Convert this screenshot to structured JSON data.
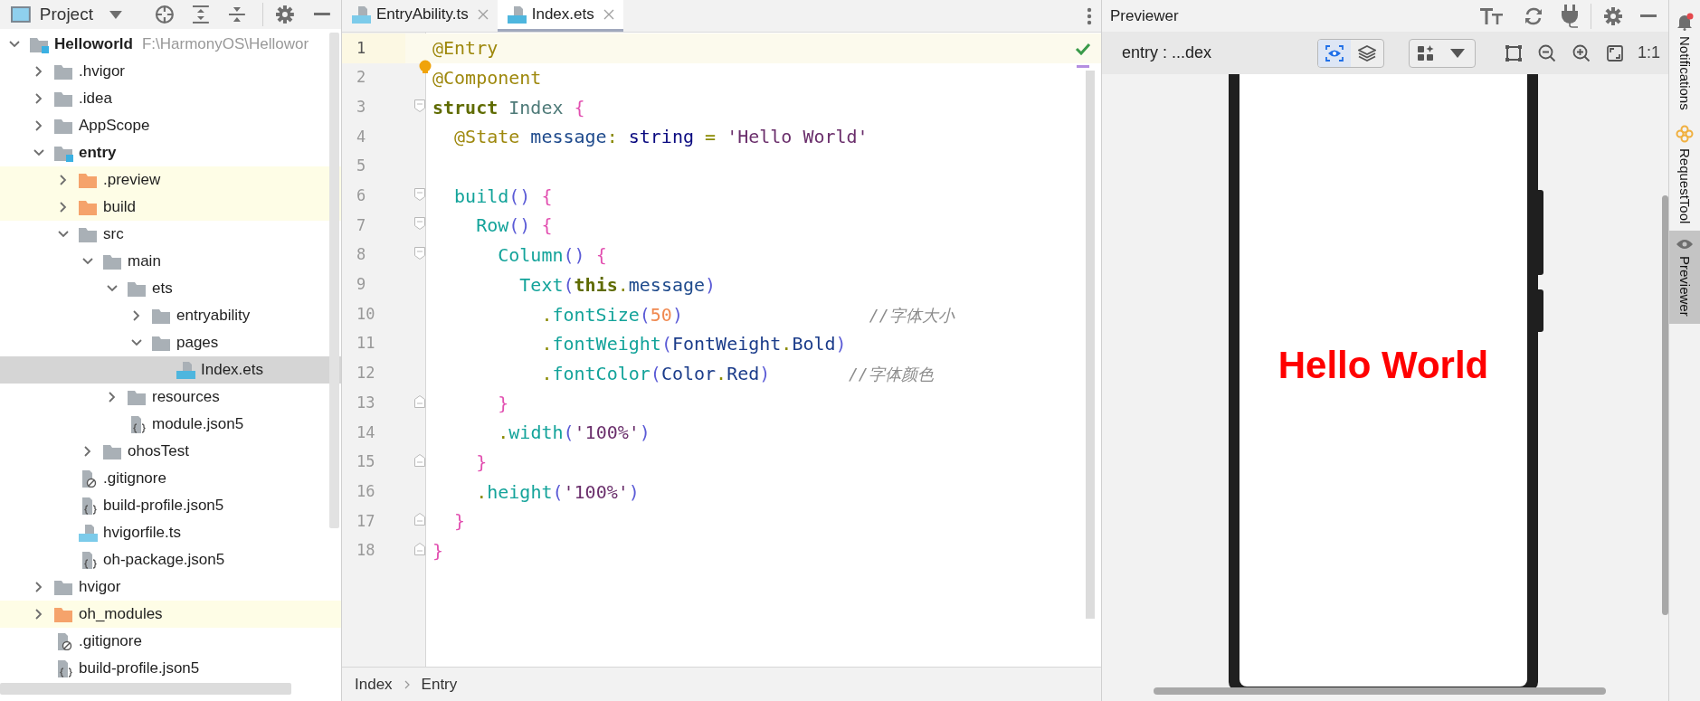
{
  "project_panel": {
    "title": "Project",
    "tree": [
      {
        "label": "Helloworld",
        "kind": "module",
        "hint": "F:\\HarmonyOS\\Hellowor",
        "expanded": true,
        "selected": false,
        "children": [
          {
            "label": ".hvigor",
            "kind": "folder",
            "expanded": false,
            "selected": false
          },
          {
            "label": ".idea",
            "kind": "folder",
            "expanded": false,
            "selected": false
          },
          {
            "label": "AppScope",
            "kind": "folder",
            "expanded": false,
            "selected": false
          },
          {
            "label": "entry",
            "kind": "module",
            "expanded": true,
            "selected": false,
            "children": [
              {
                "label": ".preview",
                "kind": "excluded",
                "expanded": false,
                "selected": false
              },
              {
                "label": "build",
                "kind": "excluded",
                "expanded": false,
                "selected": false
              },
              {
                "label": "src",
                "kind": "folder",
                "expanded": true,
                "selected": false,
                "children": [
                  {
                    "label": "main",
                    "kind": "folder",
                    "expanded": true,
                    "selected": false,
                    "children": [
                      {
                        "label": "ets",
                        "kind": "folder",
                        "expanded": true,
                        "selected": false,
                        "children": [
                          {
                            "label": "entryability",
                            "kind": "folder",
                            "expanded": false,
                            "selected": false
                          },
                          {
                            "label": "pages",
                            "kind": "folder",
                            "expanded": true,
                            "selected": false,
                            "children": [
                              {
                                "label": "Index.ets",
                                "kind": "ets",
                                "selected": true
                              }
                            ]
                          }
                        ]
                      },
                      {
                        "label": "resources",
                        "kind": "folder",
                        "expanded": false,
                        "selected": false
                      },
                      {
                        "label": "module.json5",
                        "kind": "json",
                        "selected": false
                      }
                    ]
                  },
                  {
                    "label": "ohosTest",
                    "kind": "folder",
                    "expanded": false,
                    "selected": false
                  }
                ]
              },
              {
                "label": ".gitignore",
                "kind": "ignore",
                "selected": false
              },
              {
                "label": "build-profile.json5",
                "kind": "json",
                "selected": false
              },
              {
                "label": "hvigorfile.ts",
                "kind": "ts",
                "selected": false
              },
              {
                "label": "oh-package.json5",
                "kind": "json",
                "selected": false
              }
            ]
          },
          {
            "label": "hvigor",
            "kind": "folder",
            "expanded": false,
            "selected": false
          },
          {
            "label": "oh_modules",
            "kind": "excluded",
            "expanded": false,
            "selected": false
          },
          {
            "label": ".gitignore",
            "kind": "ignore",
            "selected": false
          },
          {
            "label": "build-profile.json5",
            "kind": "json",
            "selected": false
          }
        ]
      }
    ]
  },
  "editor": {
    "tabs": [
      {
        "label": "EntryAbility.ts",
        "kind": "ts",
        "selected": false
      },
      {
        "label": "Index.ets",
        "kind": "ets",
        "selected": true
      }
    ],
    "lines": [
      {
        "number": "1",
        "current": true,
        "tokens": [
          {
            "text": "@Entry",
            "kind": "decorator"
          }
        ]
      },
      {
        "number": "2",
        "current": false,
        "tokens": [
          {
            "text": "@Component",
            "kind": "decorator"
          }
        ]
      },
      {
        "number": "3",
        "current": false,
        "kind": "fold-start",
        "tokens": [
          {
            "text": "struct",
            "kind": "keyword"
          },
          {
            "text": " Index",
            "kind": "type-name"
          },
          {
            "text": " {",
            "kind": "brace"
          }
        ]
      },
      {
        "number": "4",
        "current": false,
        "tokens": [
          {
            "text": "  @State",
            "kind": "decorator"
          },
          {
            "text": " message",
            "kind": "field"
          },
          {
            "text": ":",
            "kind": "operator"
          },
          {
            "text": " string",
            "kind": "type"
          },
          {
            "text": " = ",
            "kind": "operator"
          },
          {
            "text": "'Hello World'",
            "kind": "string"
          }
        ]
      },
      {
        "number": "5",
        "current": false
      },
      {
        "number": "6",
        "current": false,
        "kind": "fold-start",
        "tokens": [
          {
            "text": "  build",
            "kind": "call"
          },
          {
            "text": "()",
            "kind": "paren"
          },
          {
            "text": " {",
            "kind": "brace"
          }
        ]
      },
      {
        "number": "7",
        "current": false,
        "kind": "fold-start",
        "tokens": [
          {
            "text": "    Row",
            "kind": "call"
          },
          {
            "text": "()",
            "kind": "paren"
          },
          {
            "text": " {",
            "kind": "brace"
          }
        ]
      },
      {
        "number": "8",
        "current": false,
        "kind": "fold-start",
        "tokens": [
          {
            "text": "      Column",
            "kind": "call"
          },
          {
            "text": "()",
            "kind": "paren"
          },
          {
            "text": " {",
            "kind": "brace"
          }
        ]
      },
      {
        "number": "9",
        "current": false,
        "tokens": [
          {
            "text": "        Text",
            "kind": "call"
          },
          {
            "text": "(",
            "kind": "paren"
          },
          {
            "text": "this",
            "kind": "keyword"
          },
          {
            "text": ".",
            "kind": "operator"
          },
          {
            "text": "message",
            "kind": "field"
          },
          {
            "text": ")",
            "kind": "paren"
          }
        ]
      },
      {
        "number": "10",
        "current": false,
        "tokens": [
          {
            "text": "          .",
            "kind": "operator"
          },
          {
            "text": "fontSize",
            "kind": "call"
          },
          {
            "text": "(",
            "kind": "paren"
          },
          {
            "text": "50",
            "kind": "number"
          },
          {
            "text": ")",
            "kind": "paren"
          },
          {
            "text": "                   //字体大小",
            "kind": "comment"
          }
        ]
      },
      {
        "number": "11",
        "current": false,
        "tokens": [
          {
            "text": "          .",
            "kind": "operator"
          },
          {
            "text": "fontWeight",
            "kind": "call"
          },
          {
            "text": "(",
            "kind": "paren"
          },
          {
            "text": "FontWeight",
            "kind": "constant"
          },
          {
            "text": ".",
            "kind": "operator"
          },
          {
            "text": "Bold",
            "kind": "constant"
          },
          {
            "text": ")",
            "kind": "paren"
          }
        ]
      },
      {
        "number": "12",
        "current": false,
        "tokens": [
          {
            "text": "          .",
            "kind": "operator"
          },
          {
            "text": "fontColor",
            "kind": "call"
          },
          {
            "text": "(",
            "kind": "paren"
          },
          {
            "text": "Color",
            "kind": "constant"
          },
          {
            "text": ".",
            "kind": "operator"
          },
          {
            "text": "Red",
            "kind": "constant"
          },
          {
            "text": ")",
            "kind": "paren"
          },
          {
            "text": "        //字体颜色",
            "kind": "comment"
          }
        ]
      },
      {
        "number": "13",
        "current": false,
        "kind": "fold-end",
        "tokens": [
          {
            "text": "      }",
            "kind": "brace"
          }
        ]
      },
      {
        "number": "14",
        "current": false,
        "tokens": [
          {
            "text": "      .",
            "kind": "operator"
          },
          {
            "text": "width",
            "kind": "call"
          },
          {
            "text": "(",
            "kind": "paren"
          },
          {
            "text": "'100%'",
            "kind": "string"
          },
          {
            "text": ")",
            "kind": "paren"
          }
        ]
      },
      {
        "number": "15",
        "current": false,
        "kind": "fold-end",
        "tokens": [
          {
            "text": "    }",
            "kind": "brace"
          }
        ]
      },
      {
        "number": "16",
        "current": false,
        "tokens": [
          {
            "text": "    .",
            "kind": "operator"
          },
          {
            "text": "height",
            "kind": "call"
          },
          {
            "text": "(",
            "kind": "paren"
          },
          {
            "text": "'100%'",
            "kind": "string"
          },
          {
            "text": ")",
            "kind": "paren"
          }
        ]
      },
      {
        "number": "17",
        "current": false,
        "kind": "fold-end",
        "tokens": [
          {
            "text": "  }",
            "kind": "brace"
          }
        ]
      },
      {
        "number": "18",
        "current": false,
        "kind": "fold-end",
        "tokens": [
          {
            "text": "}",
            "kind": "brace"
          }
        ]
      }
    ],
    "breadcrumbs": [
      "Index",
      "Entry"
    ]
  },
  "previewer": {
    "title": "Previewer",
    "target": "entry : ...dex",
    "view_modes": [
      {
        "kind": "inspect",
        "selected": true
      },
      {
        "kind": "layers",
        "selected": false
      }
    ],
    "zoom_label": "1:1",
    "preview_text": "Hello World"
  },
  "side_tabs": [
    {
      "label": "Notifications",
      "kind": "notifications",
      "selected": false
    },
    {
      "label": "RequestTool",
      "kind": "request",
      "selected": false
    },
    {
      "label": "Previewer",
      "kind": "previewer",
      "selected": true
    }
  ]
}
